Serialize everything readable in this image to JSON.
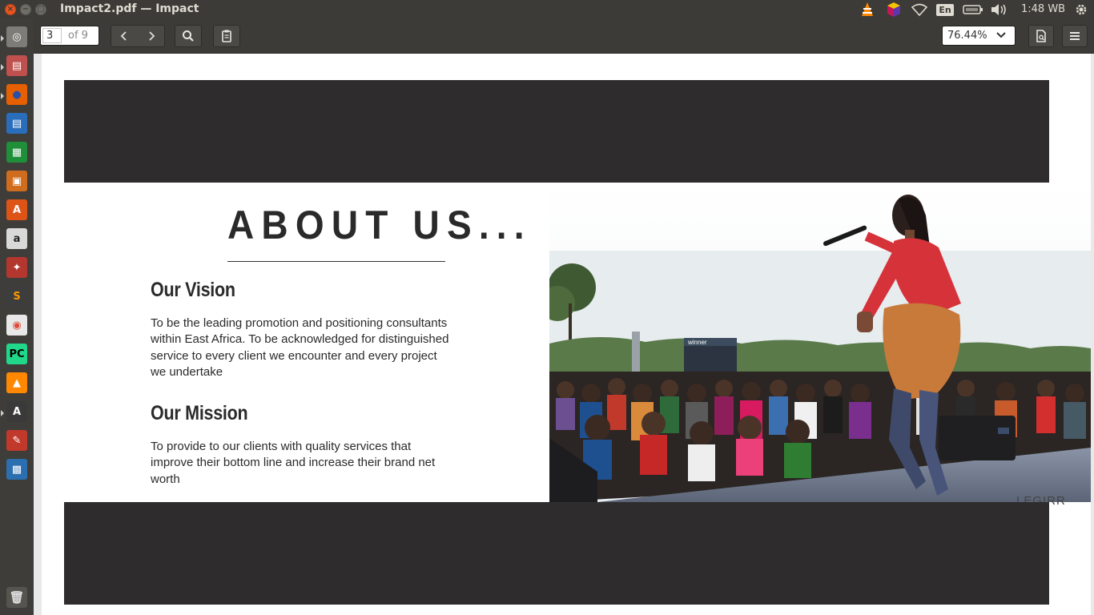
{
  "window": {
    "title": "Impact2.pdf — Impact",
    "close_glyph": "×",
    "min_glyph": "−",
    "max_glyph": "□"
  },
  "panel": {
    "language": "En",
    "clock": "1:48 WB"
  },
  "launcher": {
    "items": [
      {
        "name": "dash-home",
        "glyph": "◎",
        "bg": "#7e7c76",
        "fg": "#ffffff"
      },
      {
        "name": "files",
        "glyph": "▤",
        "bg": "#c0504d",
        "fg": "#ffffff"
      },
      {
        "name": "firefox",
        "glyph": "●",
        "bg": "#e66000",
        "fg": "#2a4fa8"
      },
      {
        "name": "libreoffice-writer",
        "glyph": "▤",
        "bg": "#2a6ebb",
        "fg": "#ffffff"
      },
      {
        "name": "libreoffice-calc",
        "glyph": "▦",
        "bg": "#1f8f3a",
        "fg": "#ffffff"
      },
      {
        "name": "libreoffice-impress",
        "glyph": "▣",
        "bg": "#d06c1e",
        "fg": "#ffffff"
      },
      {
        "name": "software-center",
        "glyph": "A",
        "bg": "#dd5416",
        "fg": "#ffffff"
      },
      {
        "name": "amazon",
        "glyph": "a",
        "bg": "#d9d9d9",
        "fg": "#222222"
      },
      {
        "name": "system-settings",
        "glyph": "✦",
        "bg": "#b3372f",
        "fg": "#ffffff"
      },
      {
        "name": "sublime-text",
        "glyph": "S",
        "bg": "#3d3d3d",
        "fg": "#ff9800"
      },
      {
        "name": "chrome",
        "glyph": "◉",
        "bg": "#e8e8e8",
        "fg": "#dd4b39"
      },
      {
        "name": "pycharm",
        "glyph": "PC",
        "bg": "#21d789",
        "fg": "#000000"
      },
      {
        "name": "vlc",
        "glyph": "▲",
        "bg": "#ff8800",
        "fg": "#ffffff"
      },
      {
        "name": "updater",
        "glyph": "A",
        "bg": "#3a3a3a",
        "fg": "#ffffff"
      },
      {
        "name": "document-viewer",
        "glyph": "✎",
        "bg": "#c0392b",
        "fg": "#ffffff"
      },
      {
        "name": "image-viewer",
        "glyph": "▩",
        "bg": "#2c6fb0",
        "fg": "#ffffff"
      }
    ],
    "trash": {
      "name": "trash",
      "glyph": "🗑",
      "bg": "#55544f",
      "fg": "#dddddd"
    }
  },
  "toolbar": {
    "page_current": "3",
    "page_total": "of 9",
    "zoom": "76.44%"
  },
  "document": {
    "heading": "ABOUT US...",
    "vision_title": "Our Vision",
    "vision_text": "To be the leading promotion and positioning consultants within East Africa. To be acknowledged for distinguished service to every client we encounter and every project we undertake",
    "mission_title": "Our Mission",
    "mission_text": "To provide to our clients with quality services that improve their bottom line and increase their brand net worth",
    "photo_sign": "winner",
    "watermark": "LEGIRR"
  },
  "colors": {
    "accent": "#e95420",
    "band": "#2e2c2d",
    "panel": "#3c3b37"
  }
}
